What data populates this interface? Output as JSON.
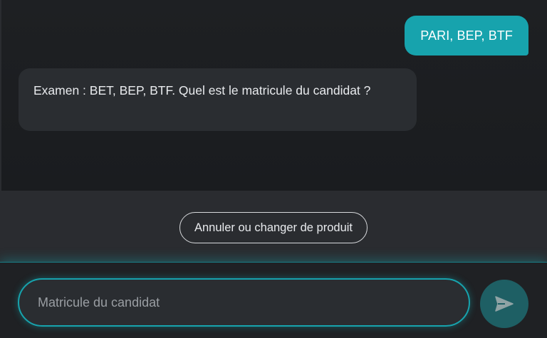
{
  "messages": {
    "user": "PARI, BEP, BTF",
    "bot": "Examen : BET, BEP, BTF. Quel est le matricule du candidat ?"
  },
  "actions": {
    "cancel_label": "Annuler ou changer de produit"
  },
  "composer": {
    "placeholder": "Matricule du candidat",
    "value": "",
    "send_icon": "send-icon"
  },
  "colors": {
    "accent": "#17a3ad",
    "send_button": "#1e5f64",
    "bot_bubble": "#2a2d31",
    "background": "#1c1e21"
  }
}
